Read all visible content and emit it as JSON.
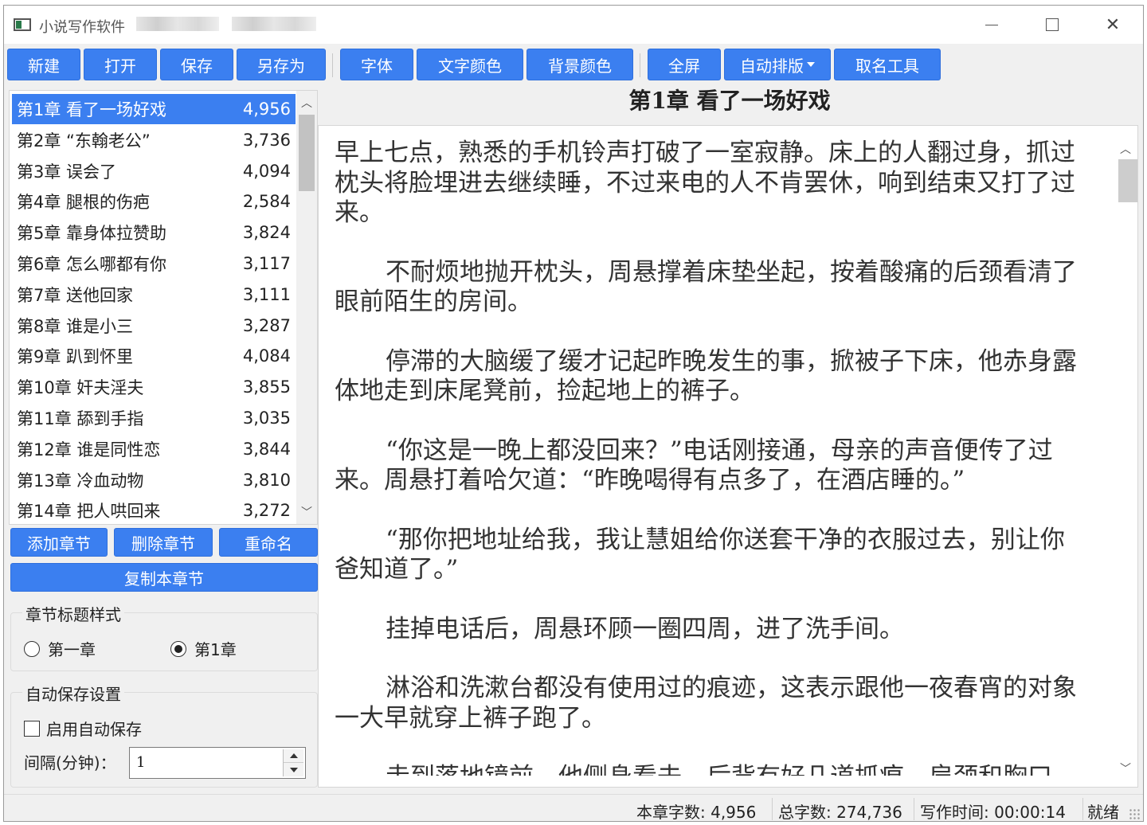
{
  "window": {
    "title": "小说写作软件",
    "minimize_icon": "minimize-icon",
    "maximize_icon": "maximize-icon",
    "close_icon": "close-icon",
    "close_glyph": "✕"
  },
  "toolbar": {
    "new": "新建",
    "open": "打开",
    "save": "保存",
    "save_as": "另存为",
    "font": "字体",
    "text_color": "文字颜色",
    "bg_color": "背景颜色",
    "fullscreen": "全屏",
    "auto_layout": "自动排版",
    "naming_tool": "取名工具"
  },
  "chapters": [
    {
      "title": "第1章 看了一场好戏",
      "count": "4,956",
      "selected": true
    },
    {
      "title": "第2章 “东翰老公”",
      "count": "3,736"
    },
    {
      "title": "第3章 误会了",
      "count": "4,094"
    },
    {
      "title": "第4章 腿根的伤疤",
      "count": "2,584"
    },
    {
      "title": "第5章 靠身体拉赞助",
      "count": "3,824"
    },
    {
      "title": "第6章 怎么哪都有你",
      "count": "3,117"
    },
    {
      "title": "第7章 送他回家",
      "count": "3,111"
    },
    {
      "title": "第8章 谁是小三",
      "count": "3,287"
    },
    {
      "title": "第9章 趴到怀里",
      "count": "4,084"
    },
    {
      "title": "第10章 奸夫淫夫",
      "count": "3,855"
    },
    {
      "title": "第11章 舔到手指",
      "count": "3,035"
    },
    {
      "title": "第12章 谁是同性恋",
      "count": "3,844"
    },
    {
      "title": "第13章 冷血动物",
      "count": "3,810"
    },
    {
      "title": "第14章 把人哄回来",
      "count": "3,272"
    }
  ],
  "chapter_actions": {
    "add": "添加章节",
    "delete": "删除章节",
    "rename": "重命名",
    "copy": "复制本章节"
  },
  "title_style": {
    "legend": "章节标题样式",
    "option_cn": "第一章",
    "option_num": "第1章",
    "selected": "第1章"
  },
  "autosave": {
    "legend": "自动保存设置",
    "enable_label": "启用自动保存",
    "enabled": false,
    "interval_label": "间隔(分钟)：",
    "interval_value": "1"
  },
  "editor": {
    "chapter_title": "第1章  看了一场好戏",
    "paragraphs": [
      "早上七点，熟悉的手机铃声打破了一室寂静。床上的人翻过身，抓过枕头将脸埋进去继续睡，不过来电的人不肯罢休，响到结束又打了过来。",
      "不耐烦地抛开枕头，周悬撑着床垫坐起，按着酸痛的后颈看清了眼前陌生的房间。",
      "停滞的大脑缓了缓才记起昨晚发生的事，掀被子下床，他赤身露体地走到床尾凳前，捡起地上的裤子。",
      "“你这是一晚上都没回来？”电话刚接通，母亲的声音便传了过来。周悬打着哈欠道：“昨晚喝得有点多了，在酒店睡的。”",
      "“那你把地址给我，我让慧姐给你送套干净的衣服过去，别让你爸知道了。”",
      "挂掉电话后，周悬环顾一圈四周，进了洗手间。",
      "淋浴和洗漱台都没有使用过的痕迹，这表示跟他一夜春宵的对象一大早就穿上裤子跑了。",
      "走到落地镜前，他侧身看去，后背有好几道抓痕，肩颈和胸口"
    ]
  },
  "status": {
    "chapter_words": "本章字数: 4,956",
    "total_words": "总字数: 274,736",
    "writing_time": "写作时间: 00:00:14",
    "state": "就绪"
  },
  "colors": {
    "accent": "#3b7ff0",
    "window_bg": "#f0f0f0",
    "text": "#222222"
  }
}
